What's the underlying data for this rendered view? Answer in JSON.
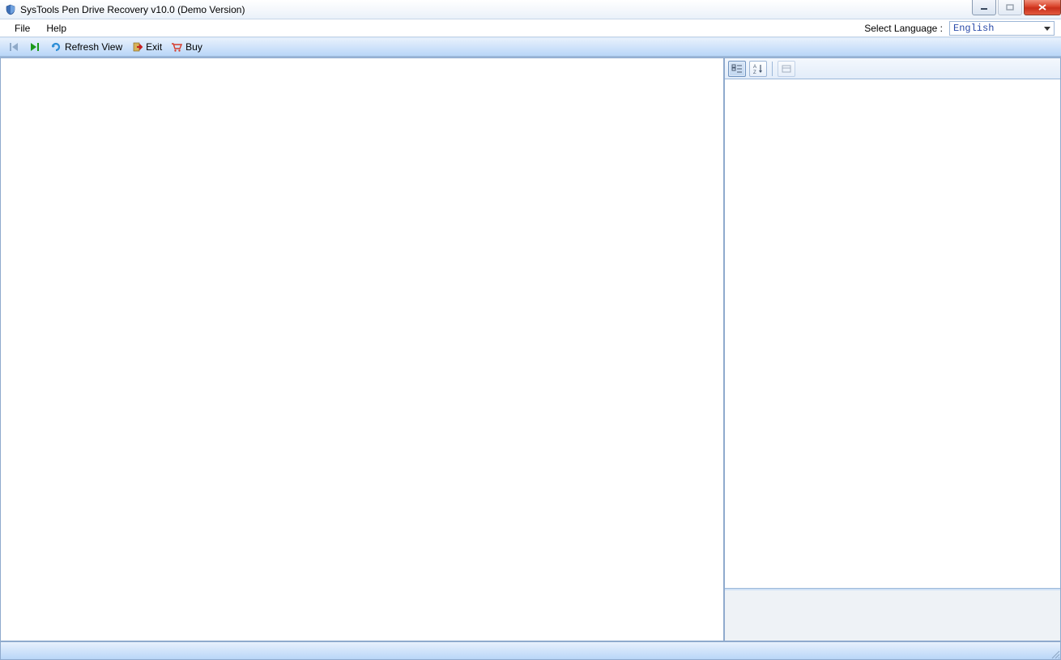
{
  "titlebar": {
    "title": "SysTools Pen Drive Recovery v10.0 (Demo Version)"
  },
  "menubar": {
    "items": [
      "File",
      "Help"
    ],
    "lang_label": "Select Language :",
    "lang_value": "English"
  },
  "toolbar": {
    "refresh_label": "Refresh View",
    "exit_label": "Exit",
    "buy_label": "Buy"
  }
}
